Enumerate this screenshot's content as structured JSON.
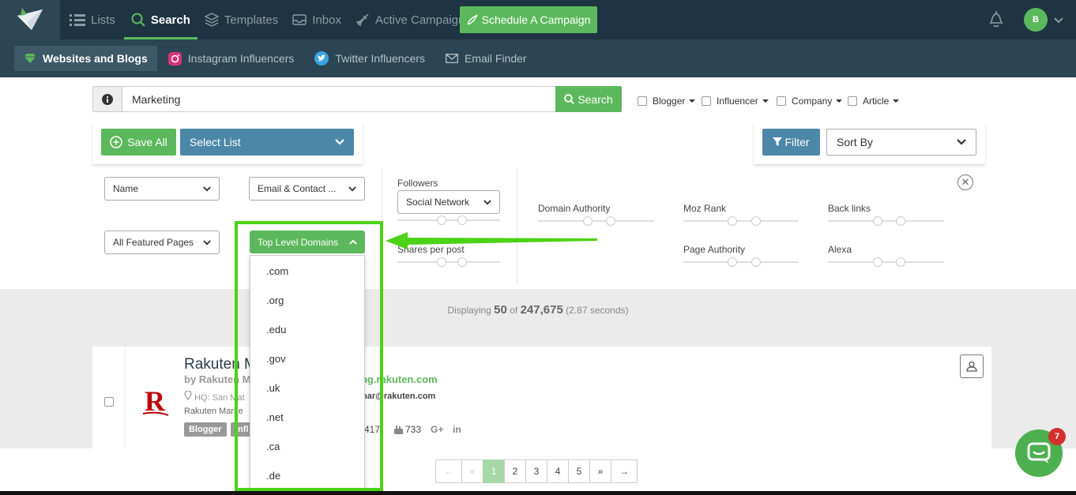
{
  "nav": {
    "items": [
      {
        "label": "Lists"
      },
      {
        "label": "Search"
      },
      {
        "label": "Templates"
      },
      {
        "label": "Inbox"
      },
      {
        "label": "Active Campaigns"
      }
    ],
    "schedule": "Schedule A Campaign",
    "avatar": "B"
  },
  "subnav": {
    "items": [
      {
        "label": "Websites and Blogs"
      },
      {
        "label": "Instagram Influencers"
      },
      {
        "label": "Twitter Influencers"
      },
      {
        "label": "Email Finder"
      }
    ]
  },
  "search": {
    "value": "Marketing",
    "button": "Search",
    "types": [
      {
        "label": "Blogger"
      },
      {
        "label": "Influencer"
      },
      {
        "label": "Company"
      },
      {
        "label": "Article"
      }
    ]
  },
  "actions": {
    "save_all": "Save All",
    "select_list": "Select List",
    "filter": "Filter",
    "sort_by": "Sort By"
  },
  "filters": {
    "name": "Name",
    "email": "Email & Contact ...",
    "featured": "All Featured Pages",
    "tld": "Top Level Domains",
    "followers": "Followers",
    "social": "Social Network",
    "shares": "Shares per post",
    "da": "Domain Authority",
    "moz": "Moz Rank",
    "backlinks": "Back links",
    "pa": "Page Authority",
    "alexa": "Alexa",
    "close": "✕"
  },
  "tld_options": [
    ".com",
    ".org",
    ".edu",
    ".gov",
    ".uk",
    ".net",
    ".ca",
    ".de"
  ],
  "display": {
    "pre": "Displaying",
    "shown": "50",
    "of": "of",
    "total": "247,675",
    "time": "(2.87 seconds)"
  },
  "result": {
    "title": "Rakuten M",
    "by": "by Rakuten M",
    "link": "ting.rakuten.com",
    "hq": "HQ: San Mat",
    "email": "mar@rakuten.com",
    "desc": "Rakuten Marke",
    "badges": [
      "Blogger",
      "Infl"
    ],
    "stat1": "417",
    "stat2": "733",
    "logo": "R"
  },
  "pagination": [
    "←",
    "«",
    "1",
    "2",
    "3",
    "4",
    "5",
    "»",
    "→"
  ],
  "chat": {
    "badge": "7"
  }
}
